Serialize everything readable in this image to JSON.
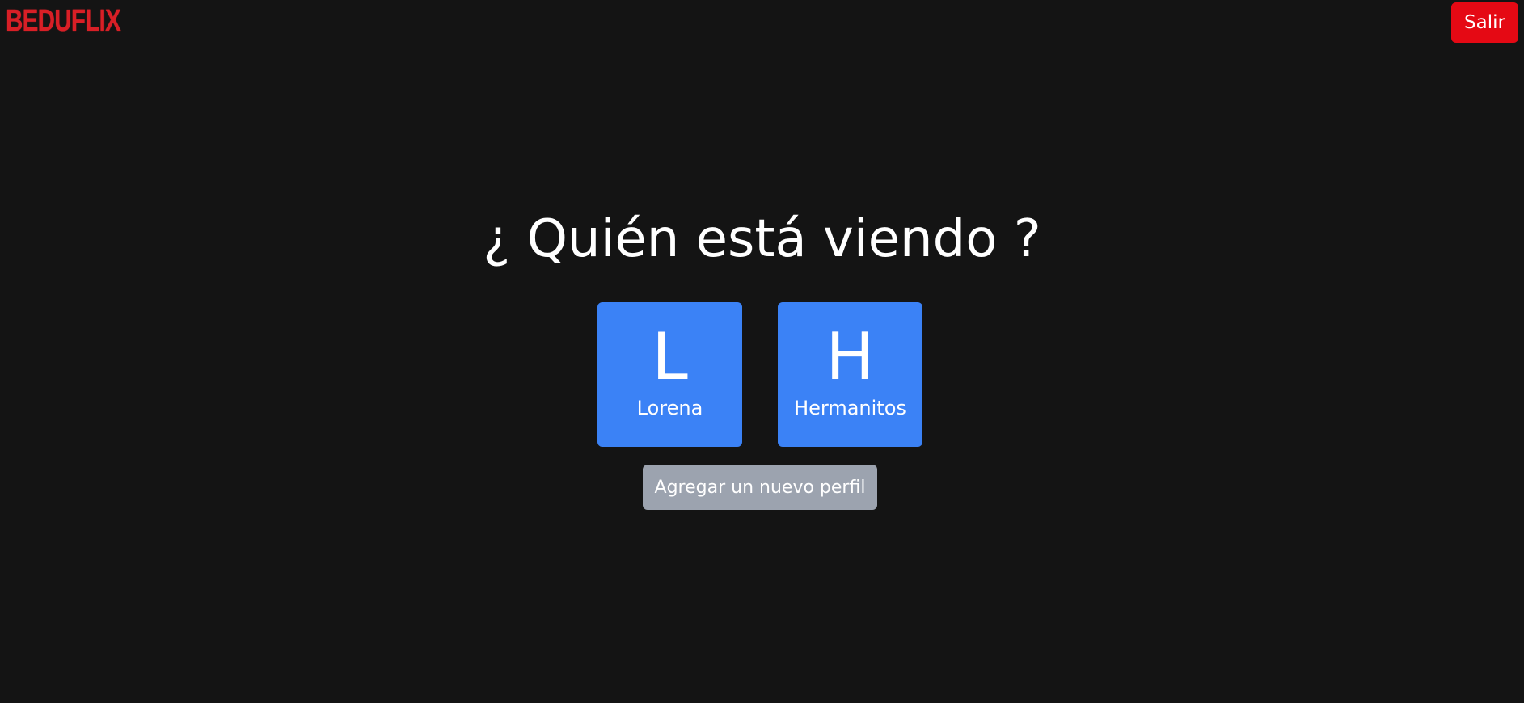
{
  "header": {
    "logo_text": "BEDUFLIX",
    "logout_label": "Salir"
  },
  "main": {
    "title": "¿ Quién está viendo ?",
    "profiles": [
      {
        "initial": "L",
        "name": "Lorena"
      },
      {
        "initial": "H",
        "name": "Hermanitos"
      }
    ],
    "add_profile_label": "Agregar un nuevo perfil"
  },
  "colors": {
    "background": "#141414",
    "brand_red": "#d81f26",
    "logout_red": "#e50914",
    "profile_blue": "#3b82f6",
    "add_button_gray": "#9ca3af"
  }
}
